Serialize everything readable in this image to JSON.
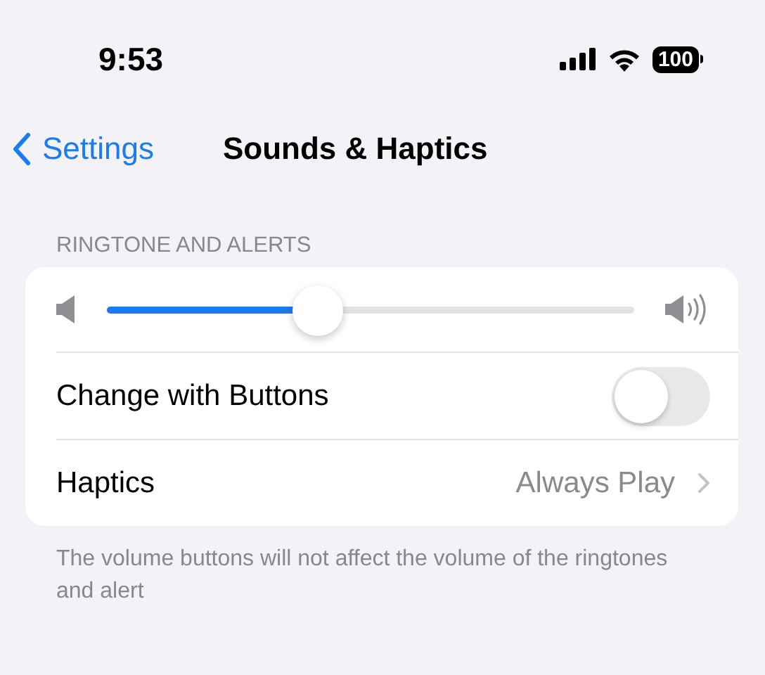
{
  "status_bar": {
    "time": "9:53",
    "battery": "100"
  },
  "nav": {
    "back": "Settings",
    "title": "Sounds & Haptics"
  },
  "section": {
    "header": "RINGTONE AND ALERTS",
    "rows": [
      {
        "kind": "slider",
        "level": 0.4
      },
      {
        "kind": "toggle",
        "label": "Change with Buttons",
        "on": false
      },
      {
        "kind": "link",
        "label": "Haptics",
        "value": "Always Play"
      }
    ],
    "footer": "The volume buttons will not affect the volume of the ringtones and alert"
  }
}
